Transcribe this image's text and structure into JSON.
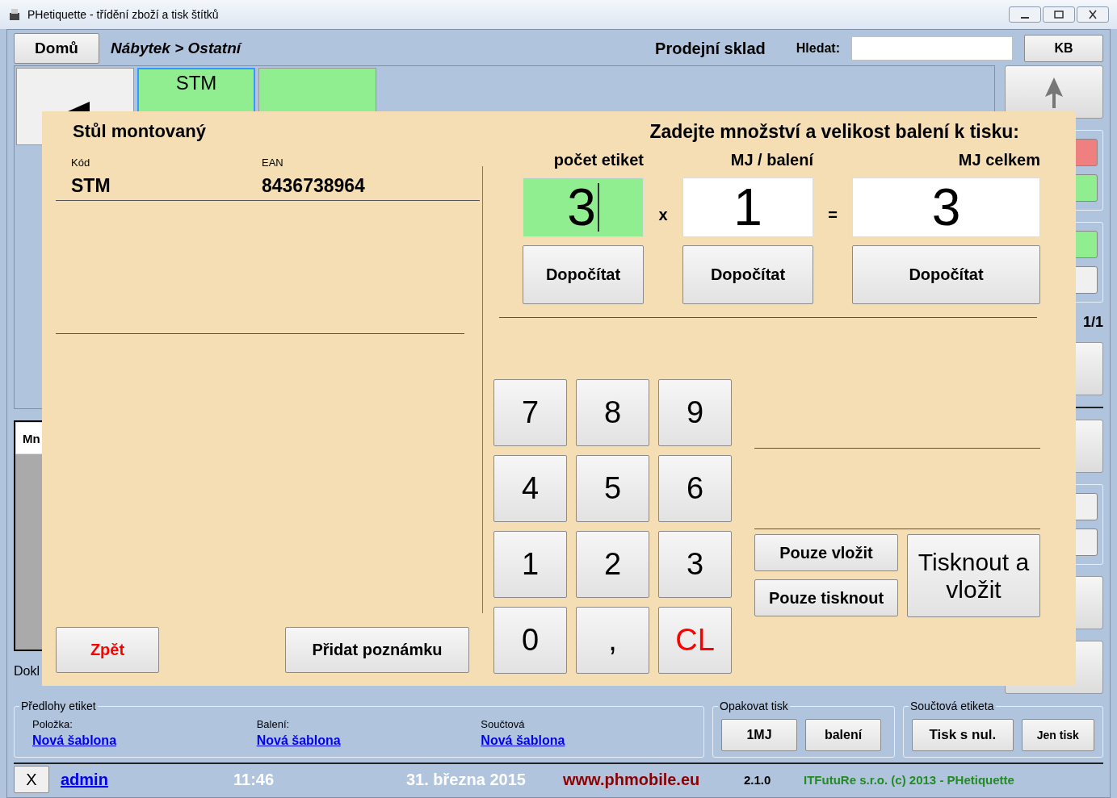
{
  "window": {
    "title": "PHetiquette - třídění zboží a tisk štítků"
  },
  "toolbar": {
    "home_button": "Domů",
    "breadcrumb": "Nábytek > Ostatní",
    "store": "Prodejní sklad",
    "search_label": "Hledat:",
    "keyboard_button": "KB"
  },
  "tiles": [
    {
      "kind": "back"
    },
    {
      "kind": "product",
      "code": "STM",
      "selected": true
    },
    {
      "kind": "product",
      "selected": false
    }
  ],
  "table": {
    "column_1": "Mn"
  },
  "doc_label": "Dokl",
  "right_panel": [
    {
      "kind": "arrow"
    },
    {
      "kind": "group",
      "buttons": [
        {
          "color": "#f08080"
        },
        {
          "color": "#90ee90"
        }
      ]
    },
    {
      "kind": "group",
      "buttons": [
        {
          "color": "#90ee90"
        },
        {
          "color": "#f0f0f0"
        }
      ]
    },
    {
      "kind": "page",
      "text": "1/1"
    },
    {
      "kind": "button"
    },
    {
      "kind": "rule"
    },
    {
      "kind": "button"
    },
    {
      "kind": "group",
      "buttons": [
        {
          "color": "#f0f0f0"
        },
        {
          "color": "#f0f0f0"
        }
      ]
    },
    {
      "kind": "button"
    },
    {
      "kind": "button"
    }
  ],
  "templates": {
    "title": "Předlohy etiket",
    "items": [
      {
        "label": "Položka:",
        "link": "Nová šablona"
      },
      {
        "label": "Balení:",
        "link": "Nová šablona"
      },
      {
        "label": "Součtová",
        "link": "Nová šablona"
      }
    ]
  },
  "repeat_print": {
    "title": "Opakovat tisk",
    "buttons": [
      "1MJ",
      "balení"
    ]
  },
  "sum_label": {
    "title": "Součtová etiketa",
    "buttons": [
      "Tisk s nul.",
      "Jen tisk"
    ]
  },
  "status_bar": {
    "close_button": "X",
    "user": "admin",
    "time": "11:46",
    "date": "31. března 2015",
    "website": "www.phmobile.eu",
    "version": "2.1.0",
    "copyright": "ITFutuRe s.r.o. (c) 2013 - PHetiquette"
  },
  "dialog": {
    "product_name": "Stůl montovaný",
    "code_label": "Kód",
    "code": "STM",
    "ean_label": "EAN",
    "ean": "8436738964",
    "prompt": "Zadejte množství a velikost balení k tisku:",
    "fields": [
      {
        "label": "počet etiket",
        "value": "3",
        "selected": true
      },
      {
        "label": "MJ / balení",
        "value": "1",
        "selected": false
      },
      {
        "label": "MJ celkem",
        "value": "3",
        "selected": false
      }
    ],
    "operators": [
      "x",
      "="
    ],
    "calc_buttons": [
      "Dopočítat",
      "Dopočítat",
      "Dopočítat"
    ],
    "keypad": [
      {
        "label": "7",
        "kind": "digit"
      },
      {
        "label": "8",
        "kind": "digit"
      },
      {
        "label": "9",
        "kind": "digit"
      },
      {
        "label": "4",
        "kind": "digit"
      },
      {
        "label": "5",
        "kind": "digit"
      },
      {
        "label": "6",
        "kind": "digit"
      },
      {
        "label": "1",
        "kind": "digit"
      },
      {
        "label": "2",
        "kind": "digit"
      },
      {
        "label": "3",
        "kind": "digit"
      },
      {
        "label": "0",
        "kind": "digit"
      },
      {
        "label": ",",
        "kind": "digit"
      },
      {
        "label": "CL",
        "kind": "clear"
      }
    ],
    "insert_only": "Pouze vložit",
    "print_only": "Pouze tisknout",
    "print_and_insert": "Tisknout a vložit",
    "back_button": "Zpět",
    "note_button": "Přidat poznámku"
  }
}
